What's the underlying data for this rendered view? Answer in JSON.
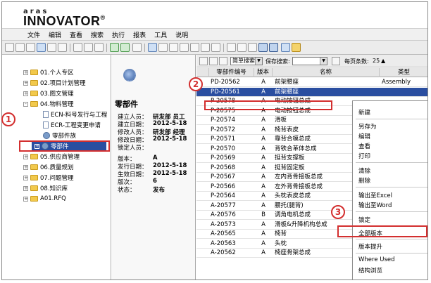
{
  "app": {
    "logo_small": "aras",
    "logo_main": "INNOVATOR",
    "logo_reg": "®"
  },
  "menu": [
    "文件",
    "编辑",
    "查看",
    "搜索",
    "执行",
    "报表",
    "工具",
    "说明"
  ],
  "tree": {
    "items": [
      {
        "label": "01.个人专区",
        "type": "folder"
      },
      {
        "label": "02.项目计划管理",
        "type": "folder"
      },
      {
        "label": "03.图文管理",
        "type": "folder"
      },
      {
        "label": "04.物料管理",
        "type": "folder"
      },
      {
        "label": "ECN-料号发行与工程",
        "type": "doc"
      },
      {
        "label": "ECR-工程变更申请",
        "type": "doc"
      },
      {
        "label": "零部件族",
        "type": "gear"
      },
      {
        "label": "零部件",
        "type": "gear"
      },
      {
        "label": "05.供应商管理",
        "type": "folder"
      },
      {
        "label": "06.质量规划",
        "type": "folder"
      },
      {
        "label": "07.问题管理",
        "type": "folder"
      },
      {
        "label": "08.知识库",
        "type": "folder"
      },
      {
        "label": "A01.RFQ",
        "type": "folder"
      }
    ]
  },
  "detail": {
    "title": "零部件",
    "fields": [
      {
        "label": "建立人员：",
        "value": "研发部 员工"
      },
      {
        "label": "建立日期：",
        "value": "2012-5-18"
      },
      {
        "label": "修改人员：",
        "value": "研发部 经理"
      },
      {
        "label": "修改日期：",
        "value": "2012-5-18"
      },
      {
        "label": "锁定人员：",
        "value": ""
      },
      {
        "label": "版本：",
        "value": "A"
      },
      {
        "label": "发行日期：",
        "value": "2012-5-18"
      },
      {
        "label": "生效日期：",
        "value": "2012-5-18"
      },
      {
        "label": "版次：",
        "value": "6"
      },
      {
        "label": "状态：",
        "value": "发布"
      }
    ]
  },
  "grid_toolbar": {
    "search_mode": "简单搜索",
    "saved_search_label": "保存搜索:",
    "page_size_label": "每页条数:",
    "page_size": "25"
  },
  "grid": {
    "columns": [
      "零部件编号",
      "版本",
      "名称",
      "类型"
    ],
    "rows": [
      [
        "PD-20562",
        "A",
        "前架腰座",
        "Assembly"
      ],
      [
        "PD-20561",
        "A",
        "前架腰座",
        ""
      ],
      [
        "P-20578",
        "A",
        "电动按钮总成",
        ""
      ],
      [
        "P-20575",
        "A",
        "电动按钮总成",
        ""
      ],
      [
        "P-20574",
        "A",
        "滑板",
        ""
      ],
      [
        "P-20572",
        "A",
        "椅背表皮",
        ""
      ],
      [
        "P-20571",
        "A",
        "靠背合模总成",
        ""
      ],
      [
        "P-20570",
        "A",
        "背铁合革体总成",
        ""
      ],
      [
        "P-20569",
        "A",
        "挺背支撑板",
        ""
      ],
      [
        "P-20568",
        "A",
        "挺背固定板",
        ""
      ],
      [
        "P-20567",
        "A",
        "左内背骨接板总成",
        ""
      ],
      [
        "P-20566",
        "A",
        "左外背骨接板总成",
        ""
      ],
      [
        "P-20564",
        "A",
        "头枕表皮总成",
        ""
      ],
      [
        "A-20577",
        "A",
        "腰托(腿背)",
        ""
      ],
      [
        "A-20576",
        "B",
        "调角电机总成",
        ""
      ],
      [
        "A-20573",
        "A",
        "滑板&升降机构总成",
        ""
      ],
      [
        "A-20565",
        "A",
        "椅背",
        ""
      ],
      [
        "A-20563",
        "A",
        "头枕",
        ""
      ],
      [
        "A-20562",
        "A",
        "椅座骨架总成",
        ""
      ]
    ]
  },
  "context_menu": {
    "items": [
      "新建",
      "另存为",
      "编辑",
      "查看",
      "打印",
      "清除",
      "删除",
      "输出至Excel",
      "输出至Word",
      "锁定",
      "全部版本",
      "版本提升",
      "Where Used",
      "结构浏览"
    ]
  },
  "annotations": [
    "1",
    "2",
    "3"
  ],
  "colors": {
    "highlight": "#d32f2f",
    "selection": "#2a4ea0"
  }
}
